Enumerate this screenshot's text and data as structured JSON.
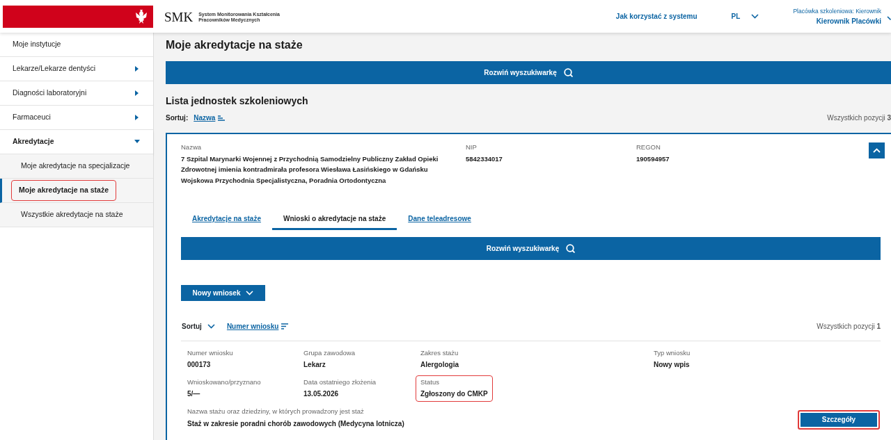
{
  "header": {
    "logo": "SMK",
    "logo_subtitle": [
      "System Monitorowania Kształcenia",
      "Pracowników Medycznych"
    ],
    "help_link": "Jak korzystać z systemu",
    "language": "PL",
    "user": {
      "role": "Placówka szkoleniowa: Kierownik",
      "name": "Kierownik Placówki"
    }
  },
  "sidebar": {
    "items": [
      {
        "label": "Moje instytucje",
        "kind": "link",
        "selected": false,
        "highlighted": false
      },
      {
        "label": "Lekarze/Lekarze dentyści",
        "kind": "group",
        "expanded": false,
        "selected": false,
        "highlighted": false
      },
      {
        "label": "Diagności laboratoryjni",
        "kind": "group",
        "expanded": false,
        "selected": false,
        "highlighted": false
      },
      {
        "label": "Farmaceuci",
        "kind": "group",
        "expanded": false,
        "selected": false,
        "highlighted": false
      },
      {
        "label": "Akredytacje",
        "kind": "group",
        "expanded": true,
        "selected": false,
        "highlighted": false,
        "children": [
          {
            "label": "Moje akredytacje na specjalizacje",
            "kind": "link",
            "selected": false,
            "highlighted": false
          },
          {
            "label": "Moje akredytacje na staże",
            "kind": "link",
            "selected": true,
            "highlighted": true
          },
          {
            "label": "Wszystkie akredytacje na staże",
            "kind": "link",
            "selected": false,
            "highlighted": false
          }
        ]
      }
    ]
  },
  "main": {
    "title": "Moje akredytacje na staże",
    "search_toggle": "Rozwiń wyszukiwarkę",
    "list_title": "Lista jednostek szkoleniowych",
    "sort": {
      "label": "Sortuj:",
      "field": "Nazwa"
    },
    "total": "Wszystkich pozycji **3**",
    "unit": {
      "expanded": true,
      "fields": [
        {
          "label": "Nazwa",
          "lines": [
            "7 Szpital Marynarki Wojennej z Przychodnią Samodzielny Publiczny Zakład Opieki Zdrowotnej imienia kontradmirała profesora Wiesława Łasińskiego w Gdańsku",
            "Wojskowa Przychodnia Specjalistyczna, Poradnia Ortodontyczna"
          ]
        },
        {
          "label": "NIP",
          "lines": [
            "5842334017"
          ]
        },
        {
          "label": "REGON",
          "lines": [
            "190594957"
          ]
        }
      ],
      "tabs": [
        {
          "label": "Akredytacje na staże",
          "selected": false
        },
        {
          "label": "Wnioski o akredytacje na staże",
          "selected": true
        },
        {
          "label": "Dane teleadresowe",
          "selected": false
        }
      ],
      "search_toggle": "Rozwiń wyszukiwarkę",
      "new_button": "Nowy wniosek",
      "sort": {
        "label": "Sortuj",
        "field": "Numer wniosku"
      },
      "total": "Wszystkich pozycji **1**",
      "application": {
        "fields": [
          {
            "label": "Numer wniosku",
            "value": "000173",
            "highlighted": false
          },
          {
            "label": "Grupa zawodowa",
            "value": "Lekarz",
            "highlighted": false
          },
          {
            "label": "Zakres stażu",
            "value": "Alergologia",
            "highlighted": false
          },
          {
            "label": "Typ wniosku",
            "value": "Nowy wpis",
            "highlighted": false
          },
          {
            "label": "Wnioskowano/przyznano",
            "value": "5/—",
            "highlighted": false
          },
          {
            "label": "Data ostatniego złożenia",
            "value": "13.05.2026",
            "highlighted": false
          },
          {
            "label": "Status",
            "value": "Zgłoszony do CMKP",
            "highlighted": true
          },
          {
            "label": "Nazwa stażu oraz dziedziny, w których prowadzony jest staż",
            "value": "Staż w zakresie poradni chorób zawodowych (Medycyna lotnicza)",
            "highlighted": false
          }
        ],
        "details_button": {
          "label": "Szczegóły",
          "highlighted": true
        }
      }
    }
  }
}
